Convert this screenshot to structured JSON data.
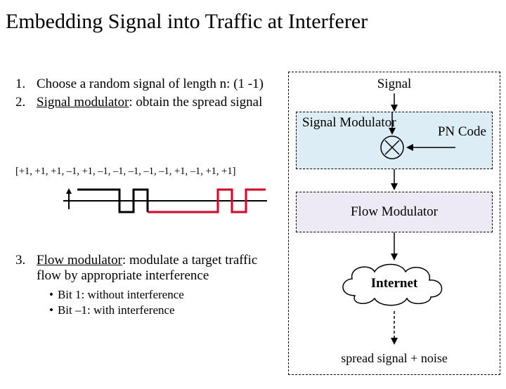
{
  "title": "Embedding Signal into Traffic at Interferer",
  "steps": {
    "1": {
      "num": "1.",
      "text": "Choose a random signal of length n:  (1 -1)"
    },
    "2": {
      "num": "2.",
      "text_a": "Signal modulator",
      "text_b": ": obtain the spread signal"
    },
    "3": {
      "num": "3.",
      "text_a": "Flow modulator",
      "text_b": ": modulate a target traffic flow by appropriate interference"
    }
  },
  "sequence": "[+1, +1, +1, –1, +1, –1, –1, –1, –1, –1, +1, –1, +1, +1]",
  "bullets": {
    "b1": "Bit  1: without interference",
    "b2": "Bit –1: with interference"
  },
  "labels": {
    "signal": "Signal",
    "smod": "Signal  Modulator",
    "pn": "PN Code",
    "fmod": "Flow Modulator",
    "internet": "Internet",
    "bottom": "spread signal + noise"
  },
  "chart_data": {
    "type": "line",
    "title": "Spread signal waveform",
    "x": [
      0,
      1,
      2,
      3,
      4,
      5,
      6,
      7,
      8,
      9,
      10,
      11,
      12,
      13,
      14
    ],
    "series": [
      {
        "name": "signal",
        "values": [
          1,
          1,
          1,
          -1,
          1,
          -1,
          -1,
          -1,
          -1,
          -1,
          1,
          -1,
          1,
          1
        ]
      }
    ],
    "ylim": [
      -1,
      1
    ]
  }
}
